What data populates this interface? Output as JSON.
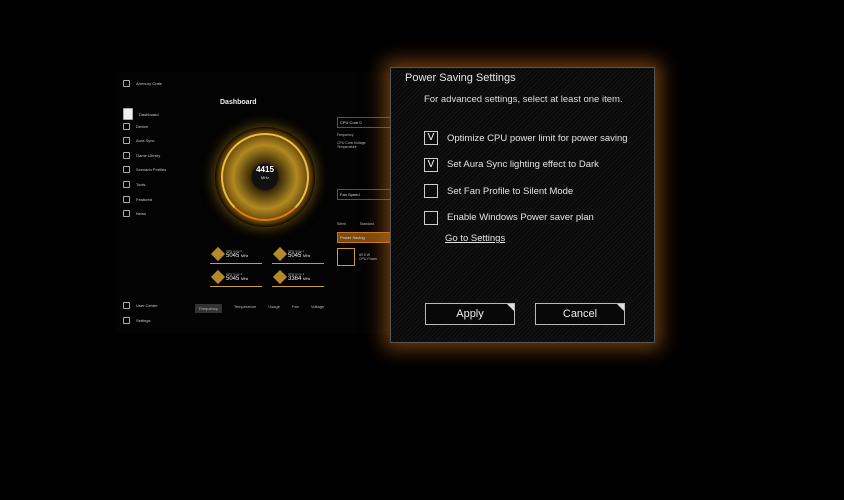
{
  "app": {
    "name": "Armoury Crate",
    "title": "Dashboard",
    "sidebar": [
      "Dashboard",
      "Device",
      "Aura Sync",
      "Game Library",
      "Scenario Profiles",
      "Tools",
      "Featured",
      "News"
    ],
    "sidebar_bottom": [
      "User Center",
      "Settings"
    ],
    "gauge": {
      "value": "4415",
      "unit": "MHz"
    },
    "cores": [
      {
        "name": "CPU Core 0",
        "value": "5045",
        "unit": "MHz"
      },
      {
        "name": "CPU Core 1",
        "value": "5045",
        "unit": "MHz"
      },
      {
        "name": "CPU Core 2",
        "value": "5045",
        "unit": "MHz"
      },
      {
        "name": "CPU Core 3",
        "value": "3364",
        "unit": "MHz"
      }
    ],
    "tabs": [
      "Frequency",
      "Temperature",
      "Usage",
      "Fan",
      "Voltage"
    ],
    "right": {
      "core": "CPU Core 0",
      "frequency": "Frequency",
      "voltage": "CPU Core Voltage",
      "temperature": "Temperature",
      "fan": "Fan Speed",
      "fan_modes": [
        "Silent",
        "Standard"
      ],
      "power": "Power Saving",
      "power_value": "89.5 W",
      "power_label": "CPU Power"
    }
  },
  "dialog": {
    "title": "Power Saving Settings",
    "subtitle": "For advanced settings, select at least one item.",
    "options": [
      {
        "label": "Optimize CPU power limit for power saving",
        "checked": true
      },
      {
        "label": "Set Aura Sync lighting effect to Dark",
        "checked": true
      },
      {
        "label": "Set Fan Profile to Silent Mode",
        "checked": false
      },
      {
        "label": "Enable Windows Power saver plan",
        "checked": false
      }
    ],
    "check_mark": "V",
    "link": "Go to Settings",
    "apply": "Apply",
    "cancel": "Cancel",
    "glow_color": "#c86e1e"
  }
}
